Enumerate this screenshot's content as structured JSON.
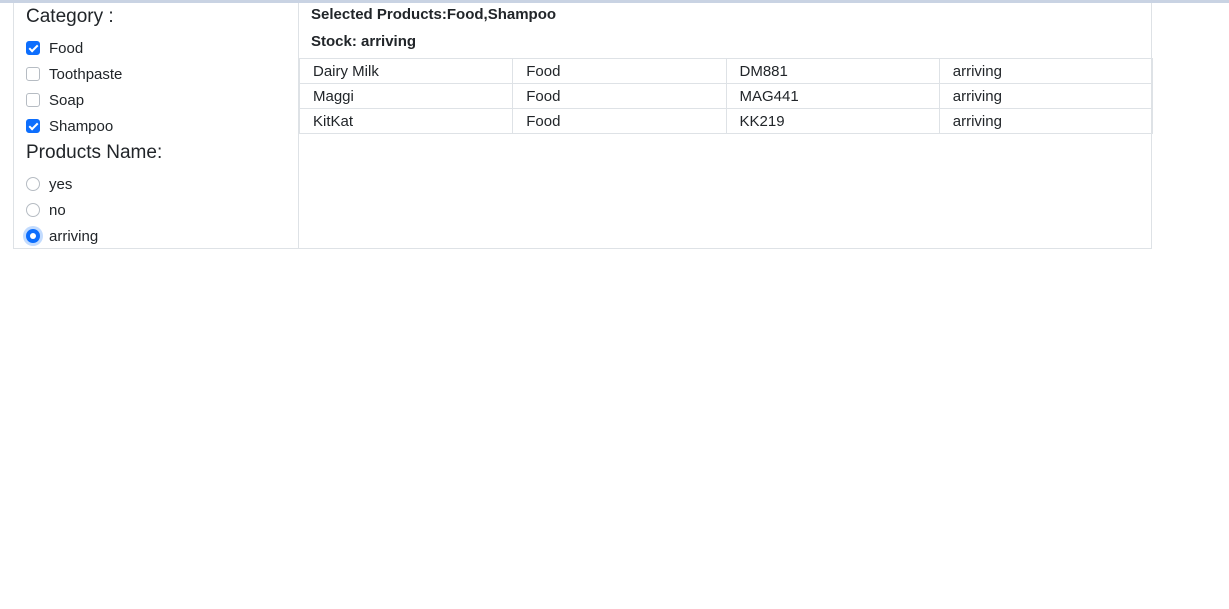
{
  "category": {
    "title": "Category :",
    "options": [
      {
        "label": "Food",
        "checked": true
      },
      {
        "label": "Toothpaste",
        "checked": false
      },
      {
        "label": "Soap",
        "checked": false
      },
      {
        "label": "Shampoo",
        "checked": true
      }
    ]
  },
  "products_name": {
    "title": "Products Name:",
    "options": [
      {
        "label": "yes",
        "checked": false
      },
      {
        "label": "no",
        "checked": false
      },
      {
        "label": "arriving",
        "checked": true
      }
    ]
  },
  "summary": {
    "selected_products": "Selected Products:Food,Shampoo",
    "stock": "Stock: arriving"
  },
  "table": {
    "rows": [
      [
        "Dairy Milk",
        "Food",
        "DM881",
        "arriving"
      ],
      [
        "Maggi",
        "Food",
        "MAG441",
        "arriving"
      ],
      [
        "KitKat",
        "Food",
        "KK219",
        "arriving"
      ]
    ]
  },
  "colors": {
    "accent": "#0d6efd",
    "border": "#dee2e6"
  }
}
